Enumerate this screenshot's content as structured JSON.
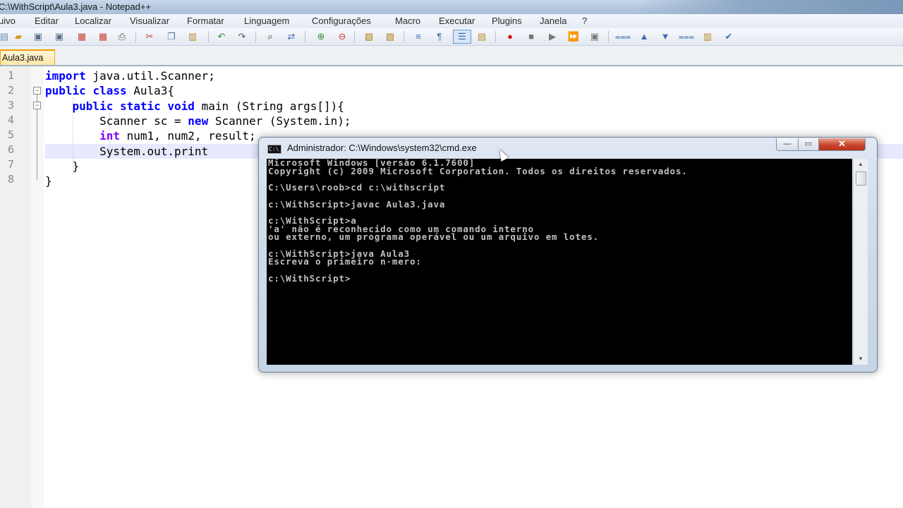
{
  "window": {
    "title": "C:\\WithScript\\Aula3.java - Notepad++"
  },
  "menu": {
    "items": [
      "uivo",
      "Editar",
      "Localizar",
      "Visualizar",
      "Formatar",
      "Linguagem",
      "Configurações",
      "Macro",
      "Executar",
      "Plugins",
      "Janela",
      "?"
    ]
  },
  "toolbar": {
    "icons": [
      "new-file-icon",
      "open-file-icon",
      "save-icon",
      "save-all-icon",
      "close-icon",
      "close-all-icon",
      "print-icon",
      "cut-icon",
      "copy-icon",
      "paste-icon",
      "undo-icon",
      "redo-icon",
      "find-icon",
      "replace-icon",
      "zoom-in-icon",
      "zoom-out-icon",
      "sync-v-icon",
      "sync-h-icon",
      "wrap-icon",
      "all-chars-icon",
      "indent-guide-icon",
      "udl-icon",
      "record-macro-icon",
      "stop-macro-icon",
      "play-macro-icon",
      "run-multiple-macro-icon",
      "save-macro-icon",
      "fold-all-icon",
      "up-icon",
      "down-icon",
      "unfold-all-icon",
      "doc-map-icon",
      "spell-check-icon"
    ]
  },
  "tabs": [
    {
      "label": "Aula3.java"
    }
  ],
  "editor": {
    "line_numbers": [
      "1",
      "2",
      "3",
      "4",
      "5",
      "6",
      "7",
      "8"
    ],
    "lines": [
      {
        "parts": [
          [
            "kw",
            "import"
          ],
          [
            "",
            " java.util.Scanner;"
          ]
        ]
      },
      {
        "parts": [
          [
            "kw",
            "public"
          ],
          [
            "",
            " "
          ],
          [
            "kw",
            "class"
          ],
          [
            "",
            " Aula3{"
          ]
        ]
      },
      {
        "parts": [
          [
            "",
            "    "
          ],
          [
            "kw",
            "public"
          ],
          [
            "",
            " "
          ],
          [
            "kw",
            "static"
          ],
          [
            "",
            " "
          ],
          [
            "kw",
            "void"
          ],
          [
            "",
            " main (String args[]){"
          ]
        ]
      },
      {
        "parts": [
          [
            "",
            "        Scanner sc = "
          ],
          [
            "kw",
            "new"
          ],
          [
            "",
            " Scanner (System.in);"
          ]
        ]
      },
      {
        "parts": [
          [
            "",
            "        "
          ],
          [
            "kw2",
            "int"
          ],
          [
            "",
            " num1, num2, result;"
          ]
        ]
      },
      {
        "parts": [
          [
            "",
            "        System.out.print"
          ]
        ]
      },
      {
        "parts": [
          [
            "",
            "    }"
          ]
        ]
      },
      {
        "parts": [
          [
            "",
            "}"
          ]
        ]
      }
    ]
  },
  "cmd": {
    "title": "Administrador: C:\\Windows\\system32\\cmd.exe",
    "icon_label": "C:\\",
    "output": "Microsoft Windows [versão 6.1.7600]\nCopyright (c) 2009 Microsoft Corporation. Todos os direitos reservados.\n\nC:\\Users\\roob>cd c:\\withscript\n\nc:\\WithScript>javac Aula3.java\n\nc:\\WithScript>a\n'a' não é reconhecido como um comando interno\nou externo, um programa operável ou um arquivo em lotes.\n\nc:\\WithScript>java Aula3\nEscreva o primeiro n·mero:\n\nc:\\WithScript>",
    "min_label": "—",
    "max_label": "▭",
    "close_label": "✕"
  }
}
